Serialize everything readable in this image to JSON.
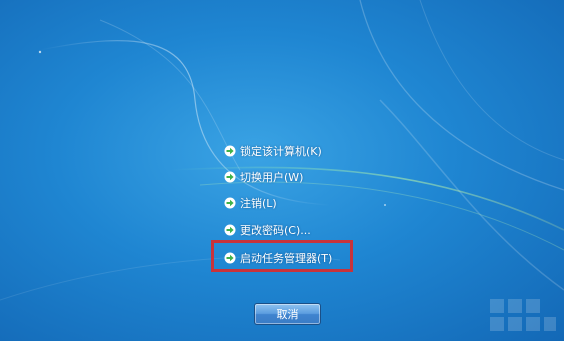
{
  "menu": {
    "items": [
      {
        "label": "锁定该计算机(K)"
      },
      {
        "label": "切换用户(W)"
      },
      {
        "label": "注销(L)"
      },
      {
        "label": "更改密码(C)..."
      },
      {
        "label": "启动任务管理器(T)"
      }
    ]
  },
  "cancel_label": "取消",
  "colors": {
    "background": "#1f86d2",
    "highlight": "#c8333b",
    "arrow": "#3fb24a"
  }
}
